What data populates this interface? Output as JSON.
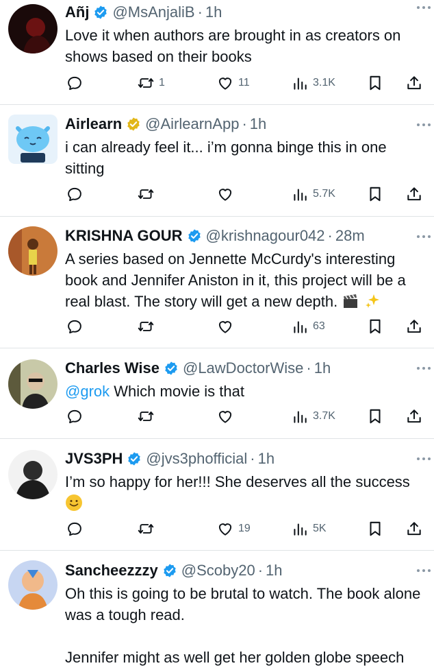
{
  "tweets": [
    {
      "display_name": "Añj",
      "badge": "blue",
      "handle": "@MsAnjaliB",
      "time": "1h",
      "text": "Love it when authors are brought in as creators on shows based on their books",
      "replies": "",
      "reposts": "1",
      "likes": "11",
      "views": "3.1K"
    },
    {
      "display_name": "Airlearn",
      "badge": "gold",
      "handle": "@AirlearnApp",
      "time": "1h",
      "text": "i can already feel it... i’m gonna binge this in one sitting",
      "replies": "",
      "reposts": "",
      "likes": "",
      "views": "5.7K"
    },
    {
      "display_name": "KRISHNA GOUR",
      "badge": "blue",
      "handle": "@krishnagour042",
      "time": "28m",
      "text": "A series based on Jennette McCurdy's interesting book and Jennifer Aniston in it, this project will be a real blast. The story will get a new depth.",
      "replies": "",
      "reposts": "",
      "likes": "",
      "views": "63"
    },
    {
      "display_name": "Charles Wise",
      "badge": "blue",
      "handle": "@LawDoctorWise",
      "time": "1h",
      "mention": "@grok",
      "text": " Which movie is that",
      "replies": "",
      "reposts": "",
      "likes": "",
      "views": "3.7K"
    },
    {
      "display_name": "JVS3PH",
      "badge": "blue",
      "handle": "@jvs3phofficial",
      "time": "1h",
      "text": "I’m so happy for her!!! She deserves all the success",
      "replies": "",
      "reposts": "",
      "likes": "19",
      "views": "5K"
    },
    {
      "display_name": "Sancheezzzy",
      "badge": "blue",
      "handle": "@Scoby20",
      "time": "1h",
      "text": "Oh this is going to be brutal to watch. The book alone was a tough read.\n\nJennifer might as well get her golden globe speech"
    }
  ],
  "colors": {
    "verified_blue": "#1d9bf0",
    "verified_gold": "#e2b719",
    "secondary_text": "#536471",
    "link": "#1d9bf0"
  },
  "icons": {
    "reply": "reply-icon",
    "repost": "repost-icon",
    "like": "like-icon",
    "views": "views-icon",
    "bookmark": "bookmark-icon",
    "share": "share-icon",
    "more": "more-icon"
  }
}
